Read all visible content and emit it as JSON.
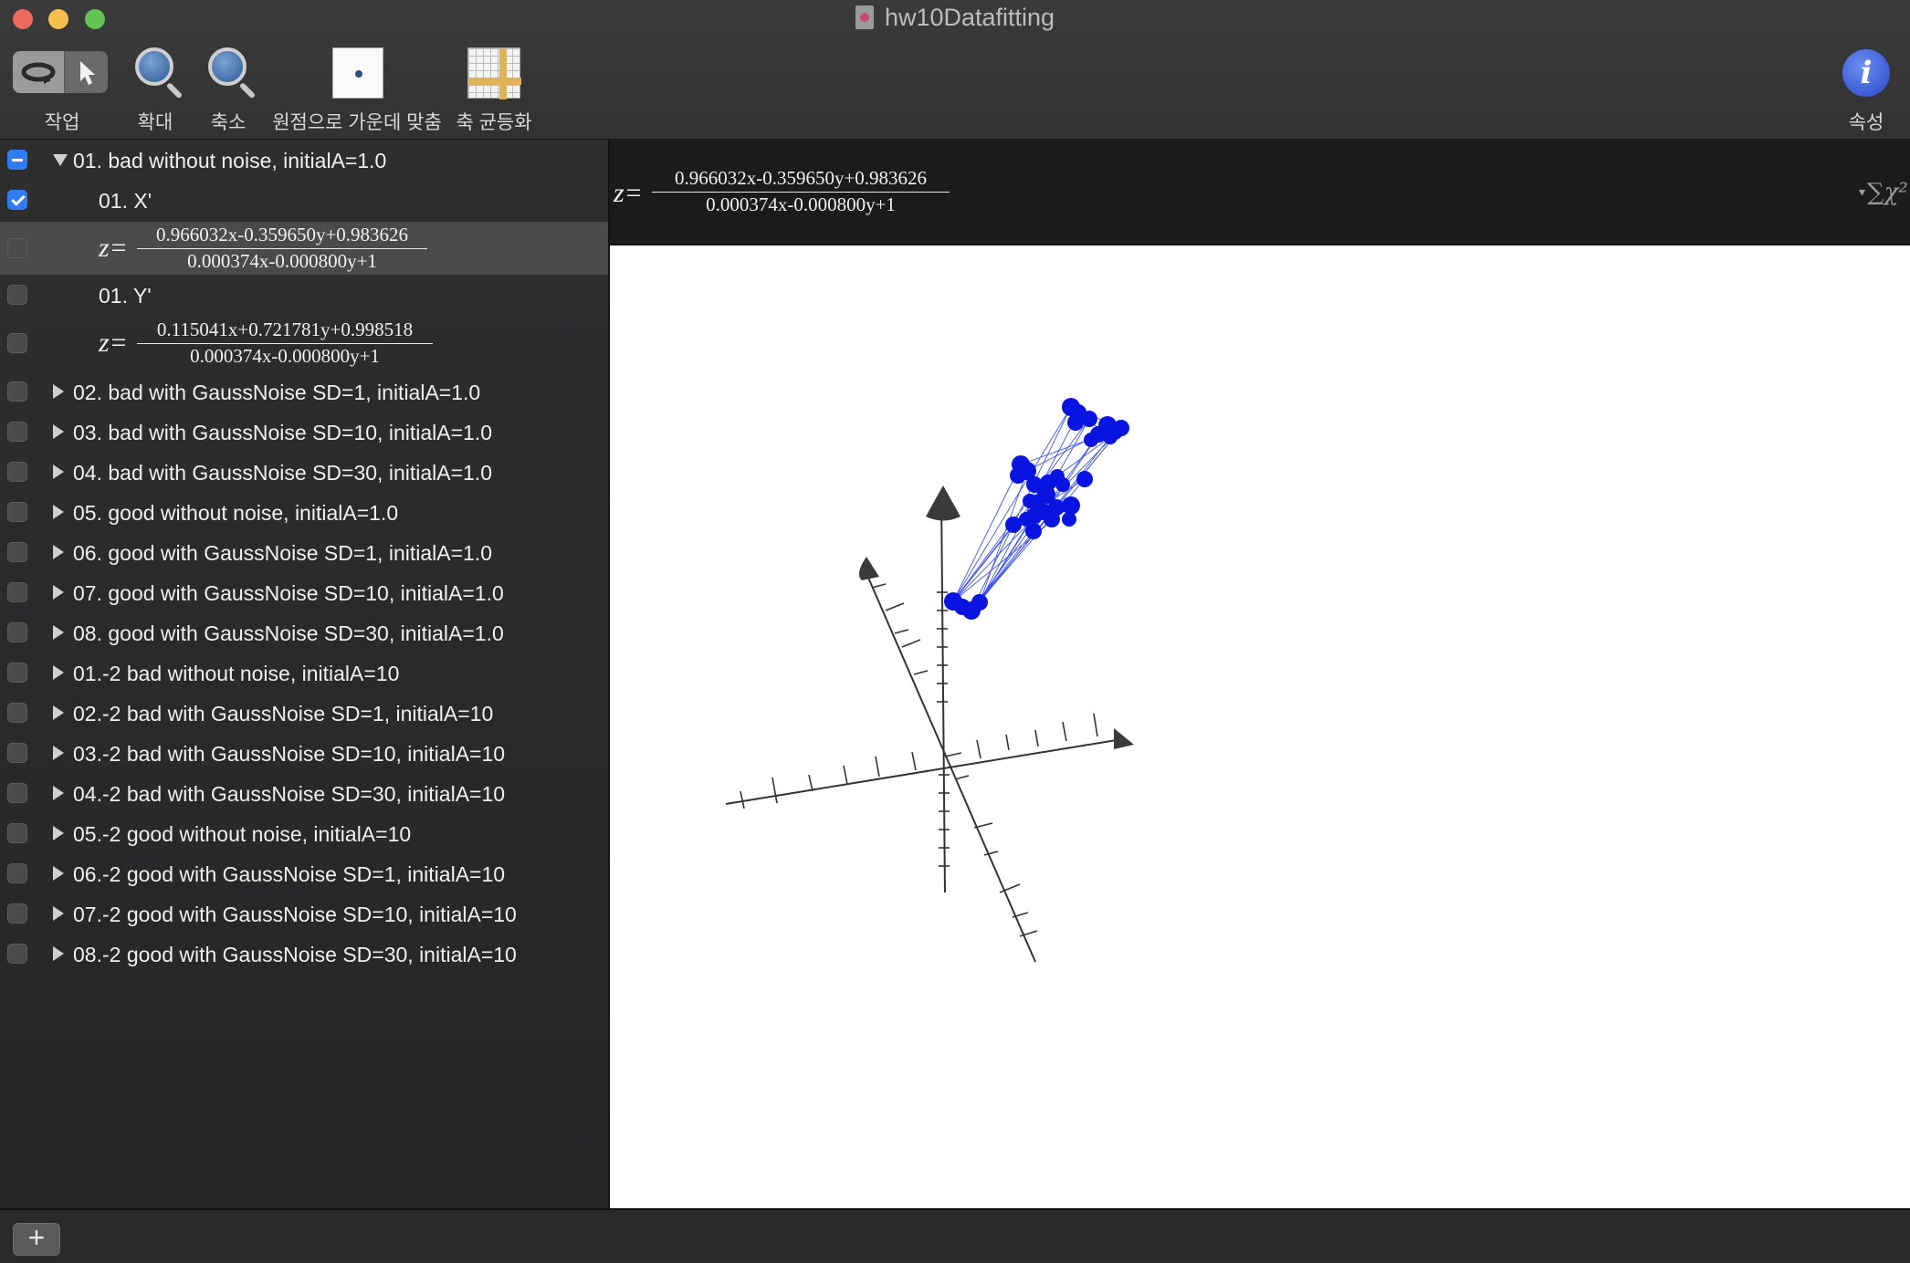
{
  "window": {
    "title": "hw10Datafitting"
  },
  "toolbar": {
    "action_label": "작업",
    "zoom_in_label": "확대",
    "zoom_out_label": "축소",
    "center_label": "원점으로 가운데 맞춤",
    "equalize_label": "축 균등화",
    "properties_label": "속성",
    "info_glyph": "i"
  },
  "sidebar": {
    "group1": {
      "label": "01. bad without noise, initialA=1.0",
      "x_label": "01. X'",
      "x_eq": {
        "z": "z=",
        "num": "0.966032x-0.359650y+0.983626",
        "den": "0.000374x-0.000800y+1"
      },
      "y_label": "01. Y'",
      "y_eq": {
        "z": "z=",
        "num": "0.115041x+0.721781y+0.998518",
        "den": "0.000374x-0.000800y+1"
      }
    },
    "items": [
      "02. bad with GaussNoise SD=1, initialA=1.0",
      "03. bad with GaussNoise SD=10, initialA=1.0",
      "04. bad with GaussNoise SD=30, initialA=1.0",
      "05. good without noise, initialA=1.0",
      "06. good with GaussNoise SD=1, initialA=1.0",
      "07. good with GaussNoise SD=10, initialA=1.0",
      "08. good with GaussNoise SD=30, initialA=1.0",
      "01.-2 bad without noise, initialA=10",
      "02.-2 bad with GaussNoise SD=1, initialA=10",
      "03.-2 bad with GaussNoise SD=10, initialA=10",
      "04.-2 bad with GaussNoise SD=30, initialA=10",
      "05.-2 good without noise, initialA=10",
      "06.-2 good with GaussNoise SD=1, initialA=10",
      "07.-2 good with GaussNoise SD=10, initialA=10",
      "08.-2 good with GaussNoise SD=30, initialA=10"
    ]
  },
  "equation_bar": {
    "z": "z=",
    "num": "0.966032x-0.359650y+0.983626",
    "den": "0.000374x-0.000800y+1",
    "sum_glyph": "∑χ²"
  },
  "bottom": {
    "add_glyph": "+"
  },
  "colors": {
    "points": "#0a14e0",
    "fit_lines": "#1e36f0",
    "axes": "#333333"
  }
}
